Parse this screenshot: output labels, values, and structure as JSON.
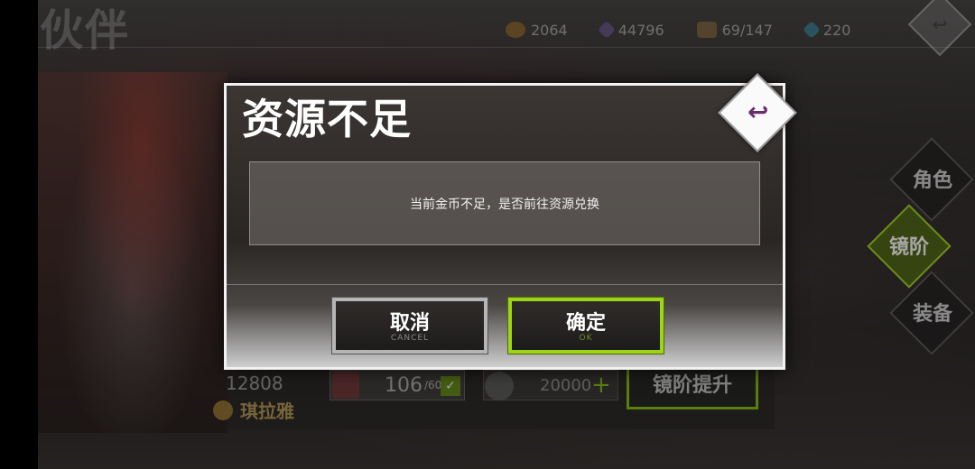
{
  "screen": {
    "title": "伙伴"
  },
  "resources": {
    "gold": "2064",
    "crystal": "44796",
    "stamina": "69/147",
    "diamond": "220"
  },
  "hero": {
    "power": "12808",
    "name": "琪拉雅",
    "fragments": "106",
    "fragments_max": "/60",
    "gold_cost": "20000",
    "upgrade_label": "镜阶提升"
  },
  "side_menu": [
    {
      "label": "角色",
      "active": false
    },
    {
      "label": "镜阶",
      "active": true
    },
    {
      "label": "装备",
      "active": false
    }
  ],
  "dialog": {
    "title": "资源不足",
    "message": "当前金币不足，是否前往资源兑换",
    "cancel_label": "取消",
    "cancel_sub": "CANCEL",
    "ok_label": "确定",
    "ok_sub": "OK"
  },
  "colors": {
    "accent_green": "#9ed416",
    "cancel_border": "#b5b5b5",
    "close_icon": "#6a2d6a"
  },
  "icons": {
    "close": "back-arrow-icon",
    "gold": "gold-coin-icon",
    "crystal": "crystal-icon",
    "stamina": "chest-icon",
    "diamond": "diamond-icon"
  }
}
